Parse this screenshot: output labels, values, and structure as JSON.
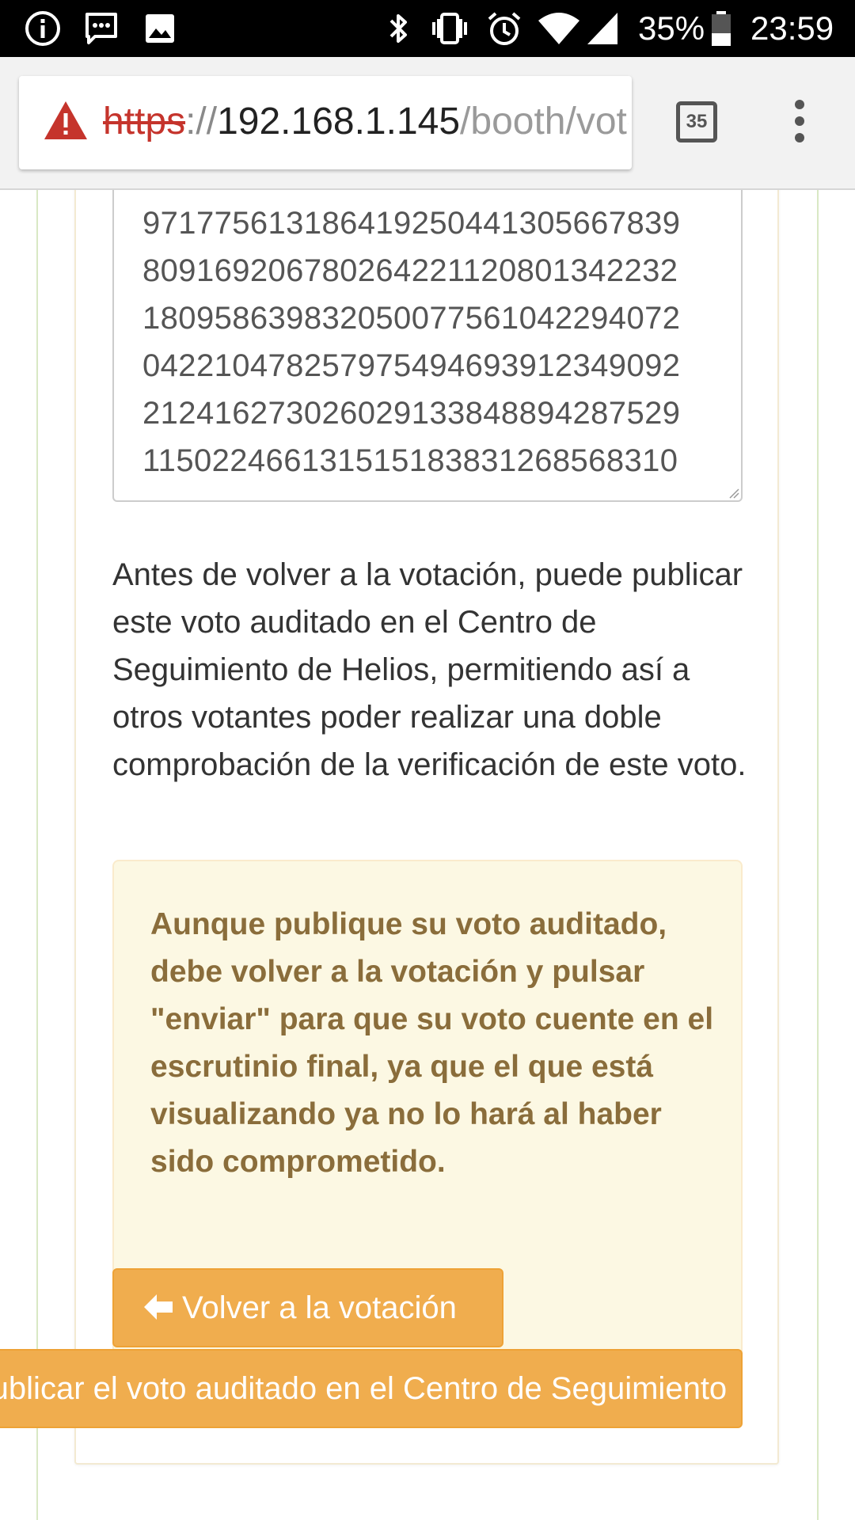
{
  "status_bar": {
    "battery_percent": "35%",
    "time": "23:59",
    "icons_left": [
      "info-icon",
      "message-icon",
      "image-icon"
    ],
    "icons_right": [
      "bluetooth-icon",
      "vibrate-icon",
      "alarm-icon",
      "wifi-icon",
      "signal-icon",
      "battery-icon"
    ]
  },
  "browser": {
    "url_scheme": "https",
    "url_sep": "://",
    "url_host": "192.168.1.145",
    "url_path": "/booth/vote.html",
    "tab_count": "35",
    "icons": [
      "warning-icon",
      "tabs-icon",
      "menu-icon"
    ],
    "warning_color": "#c5342c"
  },
  "ballot_textarea": {
    "lines": [
      "97177561318641925044130566783​9",
      "809169206780264221120801342232",
      "180958639832050077561042294072",
      "042210478257975494693912349092",
      "212416273026029133848894287529",
      "115022466131515183831268568310"
    ]
  },
  "intro_text": "Antes de volver a la votación, puede publicar este voto auditado en el Centro de Seguimiento de Helios, permitiendo así a otros votantes poder realizar una doble comprobación de la verificación de este voto.",
  "warning": {
    "text": "Aunque publique su voto auditado, debe volver a la votación y pulsar \"enviar\" para que su voto cuente en el escrutinio final, ya que el que está visualizando ya no lo hará al haber sido comprometido.",
    "color": "#8a6d3b",
    "background": "#fcf8e3"
  },
  "buttons": {
    "back_label": "Volver a la votación",
    "back_icon": "arrow-left-icon",
    "publish_label": "Publicar el voto auditado en el Centro de Seguimiento",
    "color": "#f0ad4e"
  }
}
